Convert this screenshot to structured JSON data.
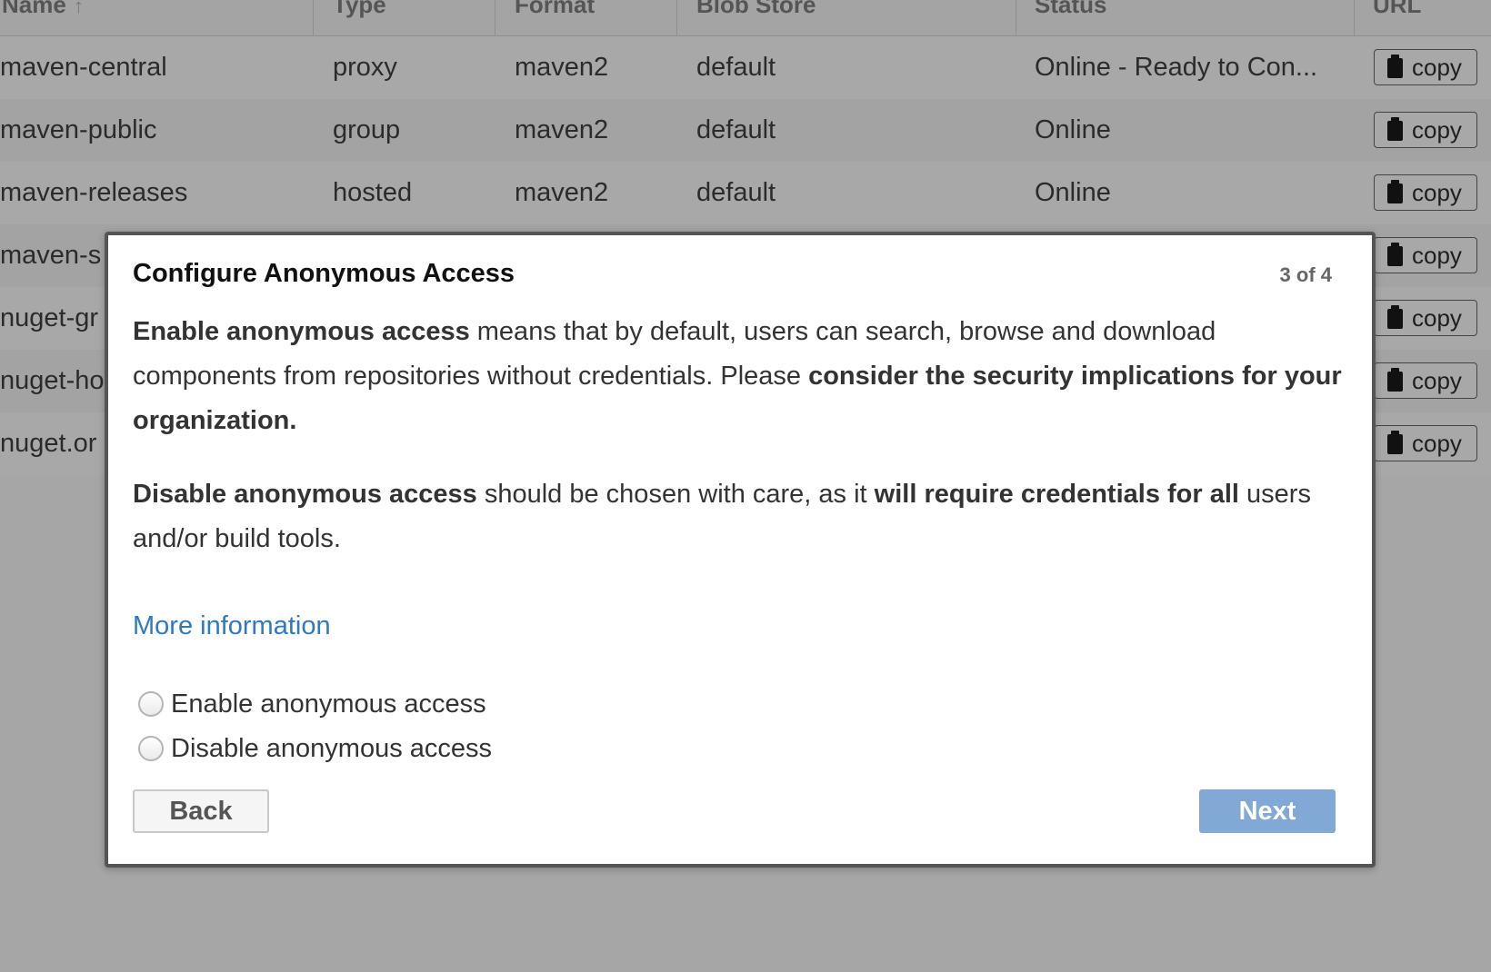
{
  "grid": {
    "columns": [
      {
        "label": "Name",
        "sort_icon": "sort-ascending-icon"
      },
      {
        "label": "Type"
      },
      {
        "label": "Format"
      },
      {
        "label": "Blob Store"
      },
      {
        "label": "Status"
      },
      {
        "label": "URL"
      }
    ],
    "rows": [
      {
        "name": "maven-central",
        "type": "proxy",
        "format": "maven2",
        "blob_store": "default",
        "status": "Online - Ready to Con...",
        "url_button": "copy"
      },
      {
        "name": "maven-public",
        "type": "group",
        "format": "maven2",
        "blob_store": "default",
        "status": "Online",
        "url_button": "copy"
      },
      {
        "name": "maven-releases",
        "type": "hosted",
        "format": "maven2",
        "blob_store": "default",
        "status": "Online",
        "url_button": "copy"
      },
      {
        "name": "maven-s",
        "type": "",
        "format": "",
        "blob_store": "",
        "status": "",
        "url_button": "copy"
      },
      {
        "name": "nuget-gr",
        "type": "",
        "format": "",
        "blob_store": "",
        "status": "",
        "url_button": "copy"
      },
      {
        "name": "nuget-ho",
        "type": "",
        "format": "",
        "blob_store": "",
        "status": "",
        "url_button": "copy"
      },
      {
        "name": "nuget.or",
        "type": "",
        "format": "",
        "blob_store": "",
        "status": "",
        "url_button": "copy"
      }
    ]
  },
  "modal": {
    "title": "Configure Anonymous Access",
    "step": "3 of 4",
    "para1": {
      "b1": "Enable anonymous access",
      "t1": " means that by default, users can search, browse and download components from repositories without credentials. Please ",
      "b2": "consider the security implications for your organization."
    },
    "para2": {
      "b1": "Disable anonymous access",
      "t1": " should be chosen with care, as it ",
      "b2": "will require credentials for all",
      "t2": " users and/or build tools."
    },
    "more_info": "More information",
    "options": [
      {
        "label": "Enable anonymous access",
        "selected": false
      },
      {
        "label": "Disable anonymous access",
        "selected": false
      }
    ],
    "back_label": "Back",
    "next_label": "Next"
  },
  "colors": {
    "link": "#2f79c2",
    "next_button": "#82a9d6",
    "overlay": "#a8a8a8"
  }
}
